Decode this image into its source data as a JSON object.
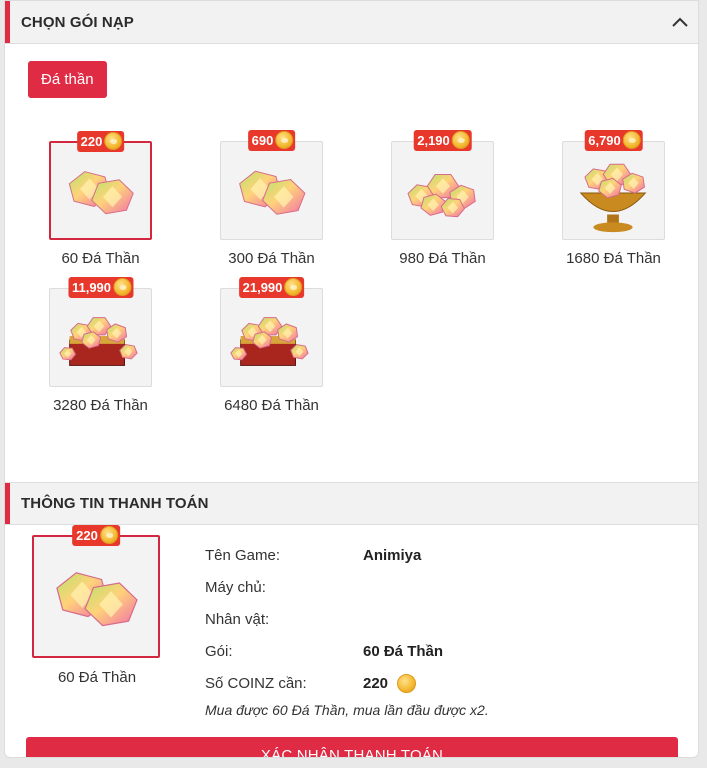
{
  "colors": {
    "accent": "#e02b45",
    "badge": "#e8372b"
  },
  "select_section": {
    "title": "CHỌN GÓI NẠP",
    "collapse_icon": "chevron-up-icon",
    "tab_label": "Đá thần"
  },
  "packages": [
    {
      "price": "220",
      "name": "60 Đá Thần",
      "selected": true,
      "art": "two-gems"
    },
    {
      "price": "690",
      "name": "300 Đá Thần",
      "selected": false,
      "art": "two-gems"
    },
    {
      "price": "2,190",
      "name": "980 Đá Thần",
      "selected": false,
      "art": "gem-pile"
    },
    {
      "price": "6,790",
      "name": "1680 Đá Thần",
      "selected": false,
      "art": "gem-chalice"
    },
    {
      "price": "11,990",
      "name": "3280 Đá Thần",
      "selected": false,
      "art": "gem-chest"
    },
    {
      "price": "21,990",
      "name": "6480 Đá Thần",
      "selected": false,
      "art": "gem-chest-big"
    }
  ],
  "payment_section": {
    "title": "THÔNG TIN THANH TOÁN",
    "selected_price": "220",
    "selected_name": "60 Đá Thần",
    "rows": {
      "game_label": "Tên Game:",
      "game_value": "Animiya",
      "server_label": "Máy chủ:",
      "server_value": "",
      "character_label": "Nhân vật:",
      "character_value": "",
      "package_label": "Gói:",
      "package_value": "60 Đá Thần",
      "coinz_label": "Số COINZ cần:",
      "coinz_value": "220"
    },
    "note": "Mua được 60 Đá Thần, mua lần đầu được x2.",
    "confirm_label": "XÁC NHẬN THANH TOÁN"
  }
}
